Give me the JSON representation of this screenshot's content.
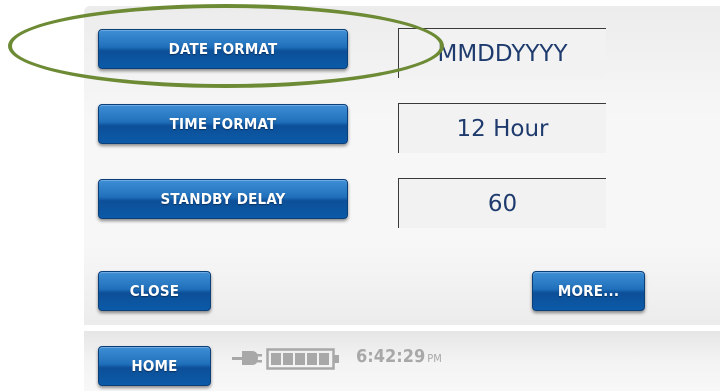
{
  "settings": {
    "date_format_label": "DATE FORMAT",
    "date_format_value": "MMDDYYYY",
    "time_format_label": "TIME FORMAT",
    "time_format_value": "12 Hour",
    "standby_delay_label": "STANDBY DELAY",
    "standby_delay_value": "60"
  },
  "actions": {
    "close_label": "CLOSE",
    "more_label": "MORE..."
  },
  "status_bar": {
    "home_label": "HOME",
    "time": "6:42:29",
    "ampm": "PM",
    "plug_icon": "power-plug-icon",
    "battery_icon": "battery-icon",
    "battery_level": 1.0
  },
  "colors": {
    "button_blue": "#1f6fbb",
    "value_text": "#1f3b6e",
    "annotation_oval": "#6d8a35",
    "status_gray": "#a8a8a8"
  }
}
